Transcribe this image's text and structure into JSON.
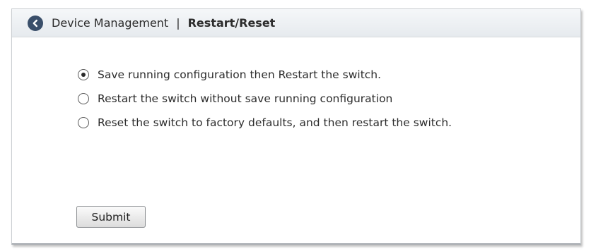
{
  "header": {
    "back_icon": "chevron-left-circle-icon",
    "parent_label": "Device Management",
    "separator": "|",
    "current_label": "Restart/Reset"
  },
  "restart_options": {
    "selected_index": 0,
    "items": [
      {
        "label": "Save running configuration then Restart the switch.",
        "selected": true
      },
      {
        "label": "Restart the switch without save running configuration",
        "selected": false
      },
      {
        "label": "Reset the switch to factory defaults, and then restart the switch.",
        "selected": false
      }
    ]
  },
  "actions": {
    "submit_label": "Submit"
  },
  "colors": {
    "header_bg": "#e8ecef",
    "back_button": "#3a4f6a",
    "text": "#2c2c2c"
  }
}
